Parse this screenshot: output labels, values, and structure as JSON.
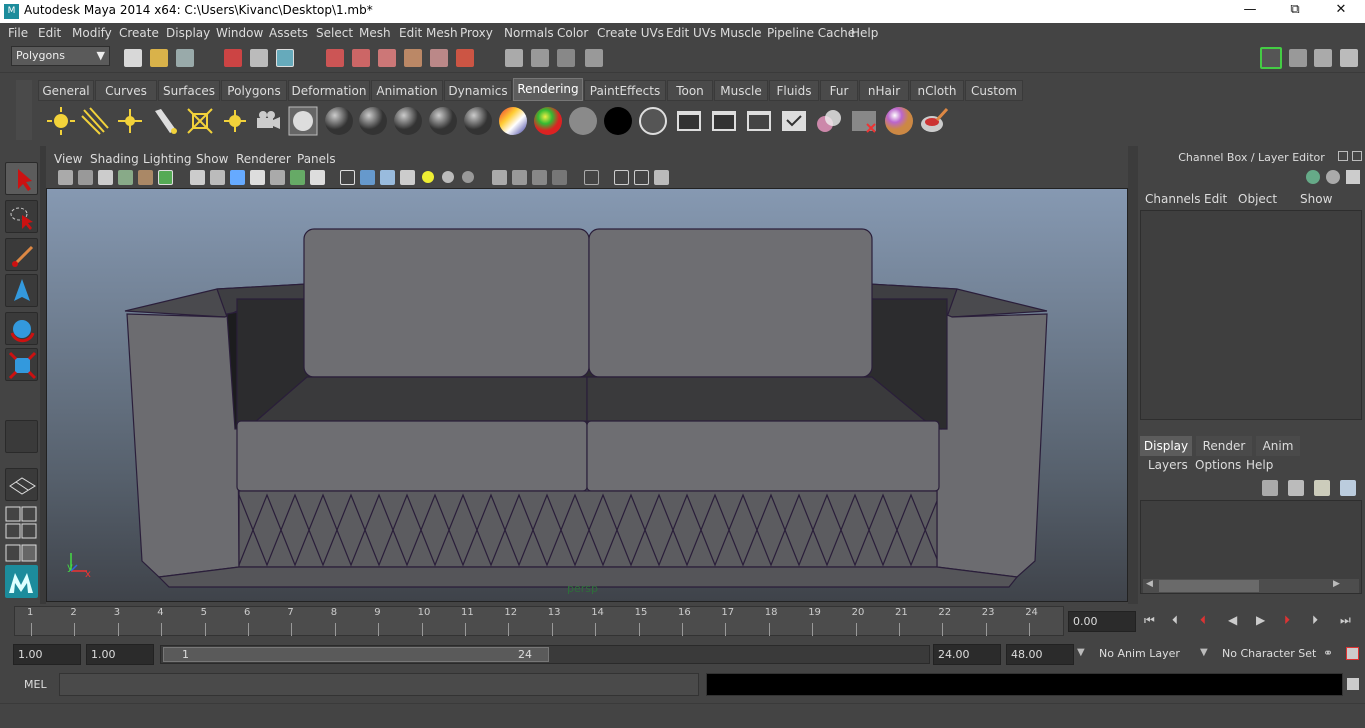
{
  "window": {
    "title": "Autodesk Maya 2014 x64: C:\\Users\\Kivanc\\Desktop\\1.mb*"
  },
  "menubar": [
    "File",
    "Edit",
    "Modify",
    "Create",
    "Display",
    "Window",
    "Assets",
    "Select",
    "Mesh",
    "Edit Mesh",
    "Proxy",
    "Normals",
    "Color",
    "Create UVs",
    "Edit UVs",
    "Muscle",
    "Pipeline Cache",
    "Help"
  ],
  "statusline": {
    "mode": "Polygons"
  },
  "shelf_tabs": [
    "General",
    "Curves",
    "Surfaces",
    "Polygons",
    "Deformation",
    "Animation",
    "Dynamics",
    "Rendering",
    "PaintEffects",
    "Toon",
    "Muscle",
    "Fluids",
    "Fur",
    "nHair",
    "nCloth",
    "Custom"
  ],
  "shelf_active_tab": "Rendering",
  "viewport": {
    "menu": [
      "View",
      "Shading",
      "Lighting",
      "Show",
      "Renderer",
      "Panels"
    ],
    "camera_label": "persp",
    "axis_y": "y",
    "axis_x": "x"
  },
  "channel_box": {
    "title": "Channel Box / Layer Editor",
    "menu": [
      "Channels",
      "Edit",
      "Object",
      "Show"
    ]
  },
  "layer_editor": {
    "tabs": [
      "Display",
      "Render",
      "Anim"
    ],
    "active_tab": "Display",
    "menu": [
      "Layers",
      "Options",
      "Help"
    ]
  },
  "timeline": {
    "ticks": [
      "1",
      "2",
      "3",
      "4",
      "5",
      "6",
      "7",
      "8",
      "9",
      "10",
      "11",
      "12",
      "13",
      "14",
      "15",
      "16",
      "17",
      "18",
      "19",
      "20",
      "21",
      "22",
      "23",
      "24"
    ],
    "current_time": "0.00"
  },
  "range": {
    "start": "1.00",
    "anim_start": "1.00",
    "range_min_label": "1",
    "range_max_label": "24",
    "end": "24.00",
    "anim_end": "48.00",
    "anim_layer": "No Anim Layer",
    "character_set": "No Character Set"
  },
  "command_line": {
    "label": "MEL"
  },
  "colors": {
    "panel": "#444444",
    "viewport_top": "#8699b2",
    "accent": "#1c8c9c"
  }
}
